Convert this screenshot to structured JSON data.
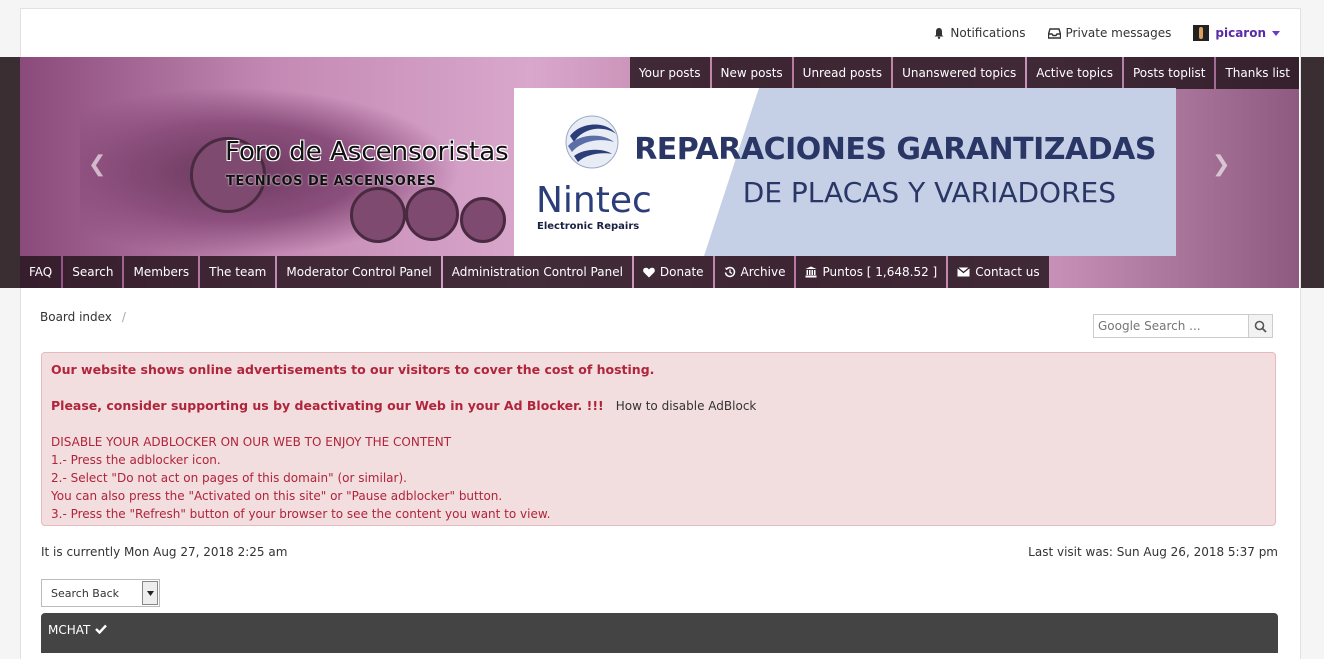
{
  "user_bar": {
    "notifications": "Notifications",
    "private_messages": "Private messages",
    "username": "picaron"
  },
  "top_nav": [
    "Your posts",
    "New posts",
    "Unread posts",
    "Unanswered topics",
    "Active topics",
    "Posts toplist",
    "Thanks list"
  ],
  "site": {
    "title": "Foro de Ascensoristas",
    "subtitle": "TECNICOS DE ASCENSORES"
  },
  "ad_banner": {
    "logo_name": "Nintec",
    "logo_sub": "Electronic Repairs",
    "line1": "REPARACIONES GARANTIZADAS",
    "line2": "DE PLACAS Y VARIADORES"
  },
  "bottom_nav": {
    "faq": "FAQ",
    "search": "Search",
    "members": "Members",
    "team": "The team",
    "mcp": "Moderator Control Panel",
    "acp": "Administration Control Panel",
    "donate": "Donate",
    "archive": "Archive",
    "puntos": "Puntos [ 1,648.52 ]",
    "contact": "Contact us"
  },
  "breadcrumb": {
    "board_index": "Board index",
    "separator": "/"
  },
  "google_search": {
    "placeholder": "Google Search ..."
  },
  "adblock_notice": {
    "line1": "Our website shows online advertisements to our visitors to cover the cost of hosting.",
    "line2": "Please, consider supporting us by deactivating our Web in your Ad Blocker. !!!",
    "how_link": "How to disable AdBlock",
    "steps": [
      "DISABLE YOUR ADBLOCKER ON OUR WEB TO ENJOY THE CONTENT",
      "1.- Press the adblocker icon.",
      "2.- Select \"Do not act on pages of this domain\" (or similar).",
      " You can also press the \"Activated on this site\" or \"Pause adblocker\" button.",
      "3.- Press the \"Refresh\" button of your browser to see the content you want to view."
    ]
  },
  "current_time": "It is currently Mon Aug 27, 2018 2:25 am",
  "last_visit": "Last visit was: Sun Aug 26, 2018 5:37 pm",
  "search_back": {
    "value": "Search Back"
  },
  "mchat": {
    "title": "MCHAT"
  },
  "colors": {
    "alert_text": "#b0243c",
    "alert_bg": "#f2dede",
    "username": "#5a2aa8",
    "nav_bg": "#281620"
  }
}
